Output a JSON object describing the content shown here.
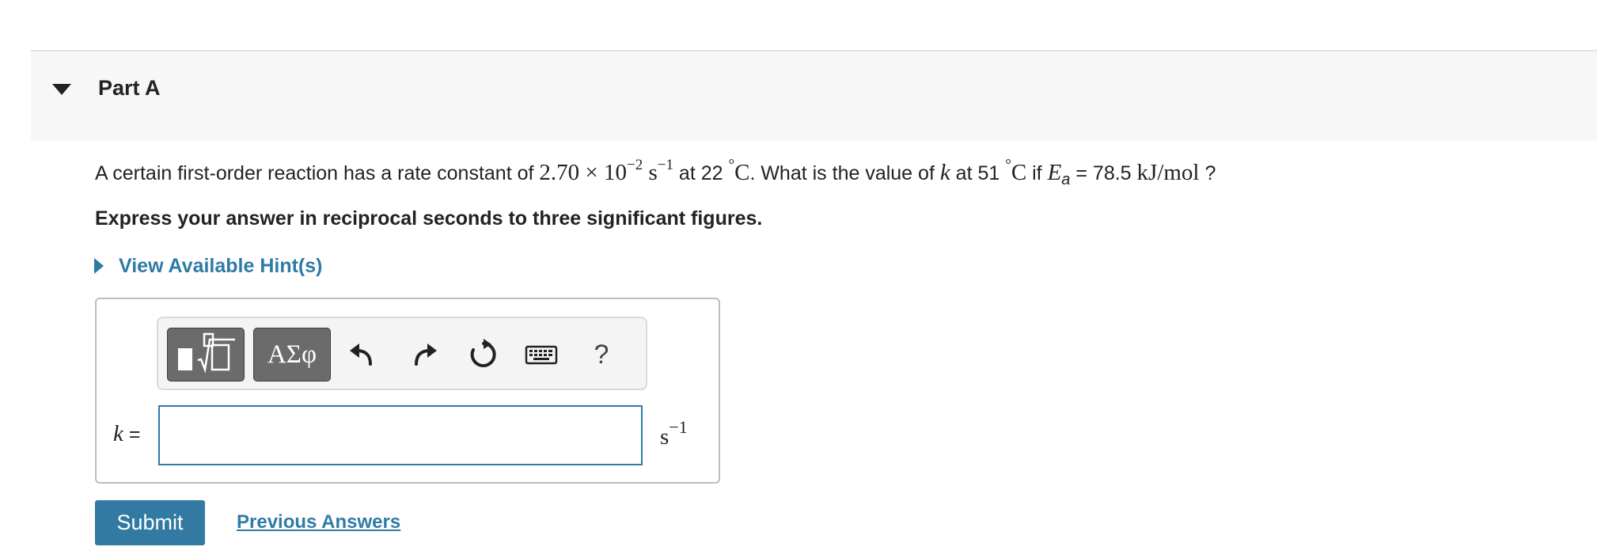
{
  "part": {
    "title": "Part A"
  },
  "question": {
    "t1": "A certain first-order reaction has a rate constant of ",
    "coef": "2.70",
    "times": "×",
    "base": "10",
    "exp": "−2",
    "unit_s": "s",
    "unit_exp": "−1",
    "t2": " at 22 ",
    "deg": "°",
    "c1": "C",
    "t3": ". What is the value of ",
    "k": "k",
    "t4": " at 51 ",
    "deg2": "°",
    "c2": "C",
    "t5": " if ",
    "E": "E",
    "a": "a",
    "t6": " = 78.5 ",
    "units": "kJ/mol",
    "t7": " ?"
  },
  "instruction": "Express your answer in reciprocal seconds to three significant figures.",
  "hint": {
    "label": "View Available Hint(s)"
  },
  "toolbar": {
    "symbols_label": "ΑΣφ",
    "help_label": "?",
    "icons": [
      "templates-icon",
      "undo-icon",
      "redo-icon",
      "reset-icon",
      "keyboard-icon",
      "help-icon"
    ]
  },
  "answer": {
    "var": "k",
    "eq": " =",
    "value": "",
    "unit": "s",
    "unit_exp": "−1"
  },
  "actions": {
    "submit_label": "Submit",
    "previous_label": "Previous Answers"
  },
  "colors": {
    "accent": "#2f7ba5",
    "submit": "#327aa1",
    "header_bg": "#f7f7f7",
    "dark_button": "#6b6b6b"
  }
}
